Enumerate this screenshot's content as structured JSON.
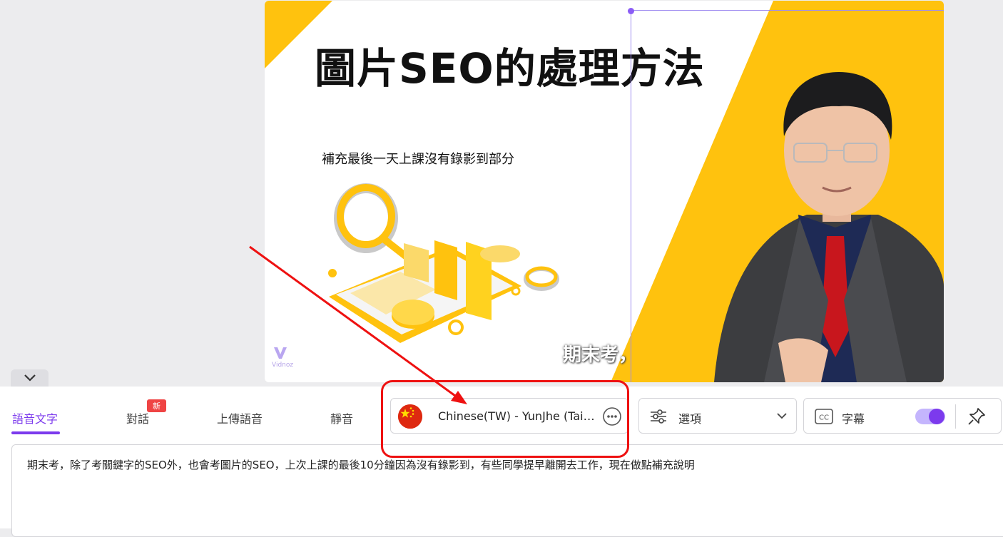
{
  "slide": {
    "title": "圖片SEO的處理方法",
    "subtitle": "補充最後一天上課沒有錄影到部分",
    "caption": "期末考，",
    "logo_text": "Vidnoz",
    "accent_color": "#ffc20e"
  },
  "tabs": [
    {
      "label": "語音文字",
      "active": true
    },
    {
      "label": "對話",
      "badge": "新"
    },
    {
      "label": "上傳語音"
    },
    {
      "label": "靜音"
    }
  ],
  "voice": {
    "name": "Chinese(TW) - YunJhe (Taiwan)",
    "flag": "china-flag-icon",
    "more": "more-options-icon"
  },
  "options": {
    "label": "選項",
    "icon": "sliders-icon"
  },
  "subtitles": {
    "label": "字幕",
    "icon": "cc-icon",
    "enabled": true
  },
  "script": {
    "text": "期末考，除了考關鍵字的SEO外，也會考圖片的SEO，上次上課的最後10分鐘因為沒有錄影到，有些同學提早離開去工作，現在做點補充說明"
  },
  "colors": {
    "brand": "#7c3aed",
    "annotation": "#ee1111"
  }
}
